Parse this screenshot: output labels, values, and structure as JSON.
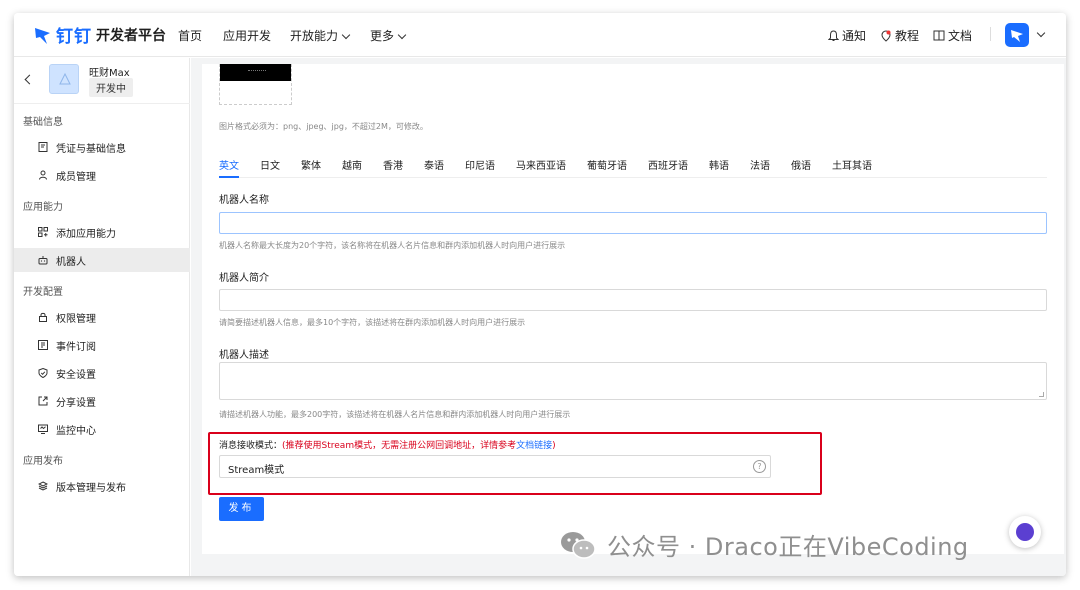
{
  "brand": {
    "name_zh": "钉钉",
    "platform": "开发者平台",
    "color": "#1a6dff"
  },
  "topnav": {
    "items": [
      "首页",
      "应用开发",
      "开放能力",
      "更多"
    ],
    "right": {
      "notify": "通知",
      "tutorial": "教程",
      "docs": "文档"
    }
  },
  "app": {
    "name": "旺财Max",
    "status": "开发中"
  },
  "sidebar": {
    "sections": [
      {
        "title": "基础信息",
        "items": [
          "凭证与基础信息",
          "成员管理"
        ]
      },
      {
        "title": "应用能力",
        "items": [
          "添加应用能力",
          "机器人"
        ]
      },
      {
        "title": "开发配置",
        "items": [
          "权限管理",
          "事件订阅",
          "安全设置",
          "分享设置",
          "监控中心"
        ]
      },
      {
        "title": "应用发布",
        "items": [
          "版本管理与发布"
        ]
      }
    ],
    "active_item": "机器人"
  },
  "form": {
    "image_hint": "图片格式必须为：png、jpeg、jpg，不超过2M，可修改。",
    "languages": [
      "英文",
      "日文",
      "繁体",
      "越南",
      "香港",
      "泰语",
      "印尼语",
      "马来西亚语",
      "葡萄牙语",
      "西班牙语",
      "韩语",
      "法语",
      "俄语",
      "土耳其语"
    ],
    "active_language": "英文",
    "name": {
      "label": "机器人名称",
      "value": "",
      "hint": "机器人名称最大长度为20个字符，该名称将在机器人名片信息和群内添加机器人时向用户进行展示"
    },
    "intro": {
      "label": "机器人简介",
      "value": "",
      "hint": "请简要描述机器人信息，最多10个字符，该描述将在群内添加机器人时向用户进行展示"
    },
    "desc": {
      "label": "机器人描述",
      "value": "",
      "hint": "请描述机器人功能，最多200字符，该描述将在机器人名片信息和群内添加机器人时向用户进行展示"
    },
    "mode": {
      "label": "消息接收模式：",
      "note_pre": "(推荐使用Stream模式，无需注册公网回调地址，详情参考",
      "note_link": "文档链接",
      "note_post": ")",
      "value": "Stream模式",
      "help": "?"
    },
    "publish_label": "发布"
  },
  "watermark": "公众号 · Draco正在VibeCoding",
  "colors": {
    "highlight_border": "#d9001b",
    "primary": "#1a6dff"
  }
}
